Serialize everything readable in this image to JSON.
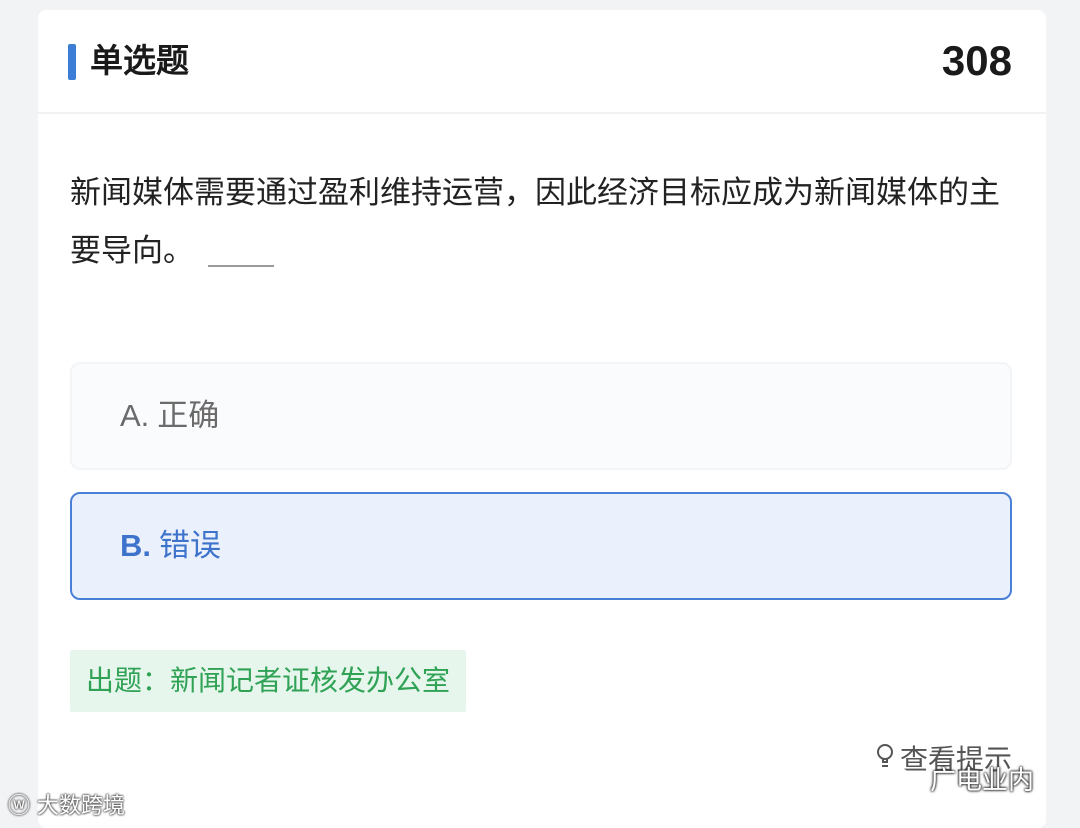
{
  "header": {
    "title": "单选题",
    "number": "308",
    "accent_color": "#3d7dd8"
  },
  "question": {
    "text": "新闻媒体需要通过盈利维持运营，因此经济目标应成为新闻媒体的主要导向。"
  },
  "options": [
    {
      "letter": "A.",
      "text": "正确",
      "selected": false
    },
    {
      "letter": "B.",
      "text": "错误",
      "selected": true
    }
  ],
  "source": {
    "label": "出题：新闻记者证核发办公室",
    "color": "#2fa255"
  },
  "hint": {
    "label": "查看提示",
    "icon": "lightbulb-icon"
  },
  "watermarks": {
    "left": "大数跨境",
    "right": "广电业内",
    "left_icon": "weibo-icon",
    "right_icon": "wechat-icon"
  }
}
